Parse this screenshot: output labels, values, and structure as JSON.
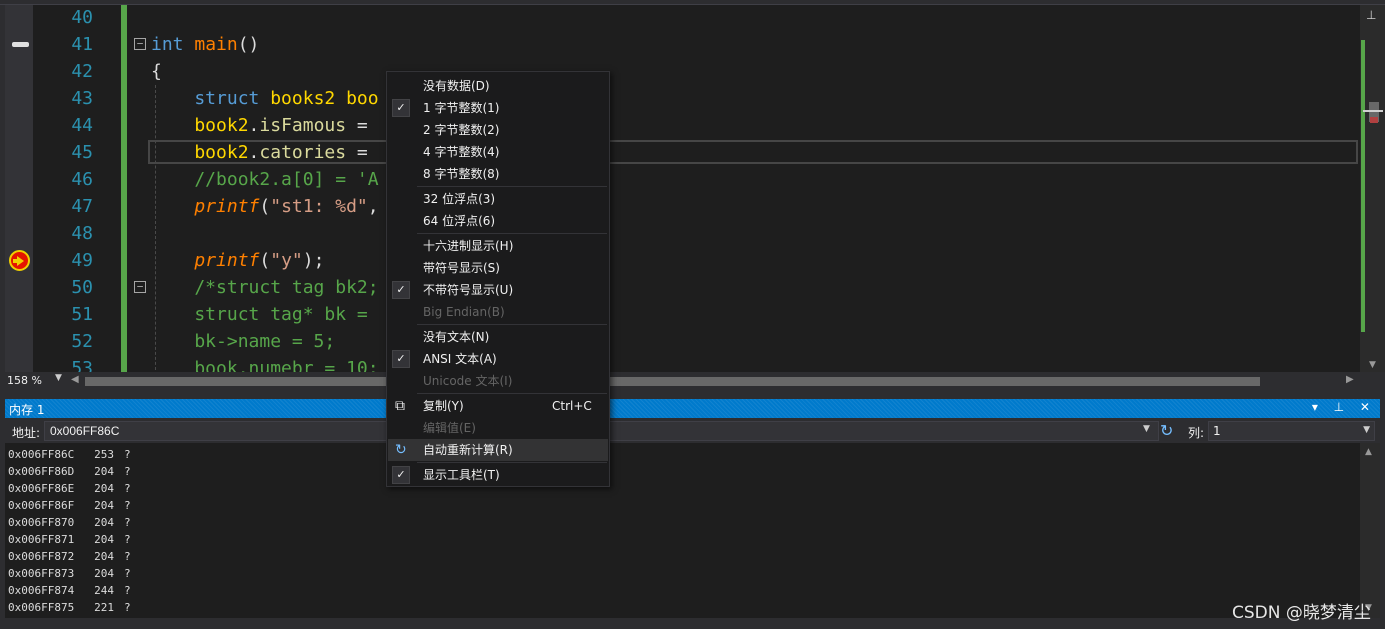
{
  "editor": {
    "lines": [
      {
        "num": "40",
        "segs": []
      },
      {
        "num": "41",
        "segs": [
          {
            "t": "int ",
            "c": "kw"
          },
          {
            "t": "main",
            "c": "fnmain"
          },
          {
            "t": "()",
            "c": ""
          }
        ]
      },
      {
        "num": "42",
        "segs": [
          {
            "t": "{",
            "c": ""
          }
        ]
      },
      {
        "num": "43",
        "segs": [
          {
            "t": "    struct ",
            "c": "kw"
          },
          {
            "t": "books2 ",
            "c": "ty"
          },
          {
            "t": "boo",
            "c": "ty"
          }
        ]
      },
      {
        "num": "44",
        "segs": [
          {
            "t": "    book2",
            "c": "ty"
          },
          {
            "t": ".",
            "c": ""
          },
          {
            "t": "isFamous",
            "c": "mem"
          },
          {
            "t": " =",
            "c": ""
          }
        ]
      },
      {
        "num": "45",
        "segs": [
          {
            "t": "    book2",
            "c": "ty"
          },
          {
            "t": ".",
            "c": ""
          },
          {
            "t": "catories",
            "c": "mem"
          },
          {
            "t": " =",
            "c": ""
          }
        ]
      },
      {
        "num": "46",
        "segs": [
          {
            "t": "    //book2.a[0] = 'A",
            "c": "cmt"
          }
        ]
      },
      {
        "num": "47",
        "segs": [
          {
            "t": "    ",
            "c": ""
          },
          {
            "t": "printf",
            "c": "fnit"
          },
          {
            "t": "(",
            "c": ""
          },
          {
            "t": "\"st1: %d\"",
            "c": "str"
          },
          {
            "t": ",",
            "c": ""
          }
        ]
      },
      {
        "num": "48",
        "segs": []
      },
      {
        "num": "49",
        "segs": [
          {
            "t": "    ",
            "c": ""
          },
          {
            "t": "printf",
            "c": "fnit"
          },
          {
            "t": "(",
            "c": ""
          },
          {
            "t": "\"y\"",
            "c": "str"
          },
          {
            "t": ");",
            "c": ""
          }
        ]
      },
      {
        "num": "50",
        "segs": [
          {
            "t": "    /*struct tag bk2;",
            "c": "cmt"
          }
        ]
      },
      {
        "num": "51",
        "segs": [
          {
            "t": "    struct tag* bk =",
            "c": "cmt"
          }
        ]
      },
      {
        "num": "52",
        "segs": [
          {
            "t": "    bk->name = 5;",
            "c": "cmt"
          }
        ]
      },
      {
        "num": "53",
        "segs": [
          {
            "t": "    book.numebr = 10;",
            "c": "cmt"
          }
        ]
      }
    ],
    "zoom": "158 %"
  },
  "memory_window": {
    "title": "内存 1",
    "title_buttons": "▾ ⊥ ✕",
    "address_label": "地址:",
    "address_value": "0x006FF86C",
    "column_label": "列:",
    "column_value": "1",
    "rows": [
      {
        "addr": "0x006FF86C",
        "val": "253",
        "ch": "?"
      },
      {
        "addr": "0x006FF86D",
        "val": "204",
        "ch": "?"
      },
      {
        "addr": "0x006FF86E",
        "val": "204",
        "ch": "?"
      },
      {
        "addr": "0x006FF86F",
        "val": "204",
        "ch": "?"
      },
      {
        "addr": "0x006FF870",
        "val": "204",
        "ch": "?"
      },
      {
        "addr": "0x006FF871",
        "val": "204",
        "ch": "?"
      },
      {
        "addr": "0x006FF872",
        "val": "204",
        "ch": "?"
      },
      {
        "addr": "0x006FF873",
        "val": "204",
        "ch": "?"
      },
      {
        "addr": "0x006FF874",
        "val": "244",
        "ch": "?"
      },
      {
        "addr": "0x006FF875",
        "val": "221",
        "ch": "?"
      }
    ]
  },
  "context_menu": {
    "items": [
      {
        "label": "没有数据(D)",
        "checked": false,
        "disabled": false
      },
      {
        "label": "1 字节整数(1)",
        "checked": true,
        "disabled": false
      },
      {
        "label": "2 字节整数(2)",
        "checked": false,
        "disabled": false
      },
      {
        "label": "4 字节整数(4)",
        "checked": false,
        "disabled": false
      },
      {
        "label": "8 字节整数(8)",
        "checked": false,
        "disabled": false
      },
      {
        "sep": true
      },
      {
        "label": "32 位浮点(3)",
        "checked": false,
        "disabled": false
      },
      {
        "label": "64 位浮点(6)",
        "checked": false,
        "disabled": false
      },
      {
        "sep": true
      },
      {
        "label": "十六进制显示(H)",
        "checked": false,
        "disabled": false
      },
      {
        "label": "带符号显示(S)",
        "checked": false,
        "disabled": false
      },
      {
        "label": "不带符号显示(U)",
        "checked": true,
        "disabled": false
      },
      {
        "label": "Big Endian(B)",
        "checked": false,
        "disabled": true
      },
      {
        "sep": true
      },
      {
        "label": "没有文本(N)",
        "checked": false,
        "disabled": false
      },
      {
        "label": "ANSI 文本(A)",
        "checked": true,
        "disabled": false
      },
      {
        "label": "Unicode 文本(I)",
        "checked": false,
        "disabled": true
      },
      {
        "sep": true
      },
      {
        "label": "复制(Y)",
        "shortcut": "Ctrl+C",
        "icon": "copy-icon",
        "disabled": false
      },
      {
        "label": "编辑值(E)",
        "disabled": true
      },
      {
        "label": "自动重新计算(R)",
        "icon": "refresh-icon",
        "hover": true,
        "disabled": false
      },
      {
        "sep": true
      },
      {
        "label": "显示工具栏(T)",
        "checked": true,
        "disabled": false
      }
    ]
  },
  "watermark": "CSDN @晓梦清尘",
  "colors": {
    "editor_bg": "#1e1e1e",
    "accent": "#007acc",
    "menu_bg": "#1b1b1c",
    "change_bar": "#57a64a"
  }
}
